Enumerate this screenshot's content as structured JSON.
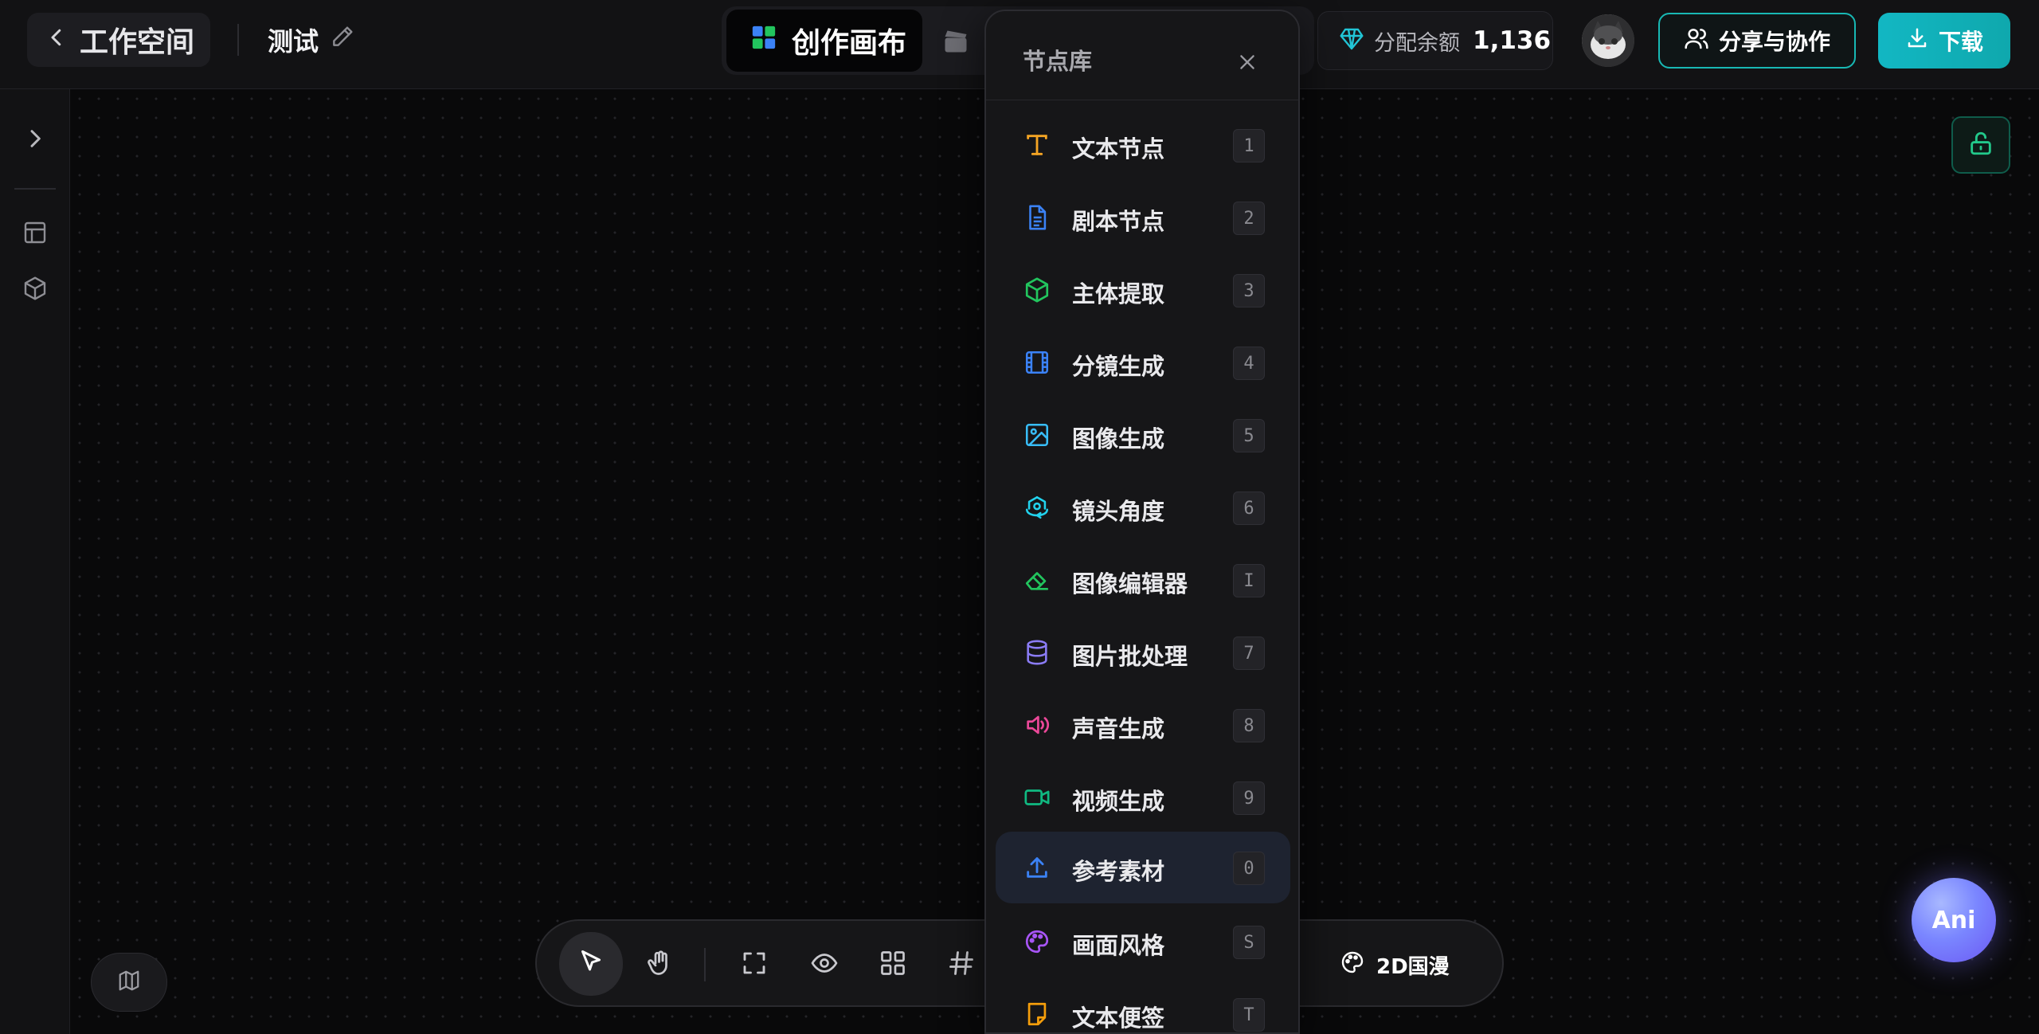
{
  "header": {
    "back_label": "工作空间",
    "project_name": "测试",
    "mode_active_label": "创作画布",
    "balance_label": "分配余额",
    "balance_value": "1,136",
    "share_label": "分享与协作",
    "download_label": "下载"
  },
  "node_library": {
    "title": "节点库",
    "items": [
      {
        "label": "文本节点",
        "key": "1",
        "icon": "text-type-icon",
        "color": "#f5a524"
      },
      {
        "label": "剧本节点",
        "key": "2",
        "icon": "document-icon",
        "color": "#3b82f6"
      },
      {
        "label": "主体提取",
        "key": "3",
        "icon": "cube-icon",
        "color": "#22c55e"
      },
      {
        "label": "分镜生成",
        "key": "4",
        "icon": "film-icon",
        "color": "#3b82f6"
      },
      {
        "label": "图像生成",
        "key": "5",
        "icon": "image-icon",
        "color": "#38bdf8"
      },
      {
        "label": "镜头角度",
        "key": "6",
        "icon": "orbit-camera-icon",
        "color": "#22d3ee"
      },
      {
        "label": "图像编辑器",
        "key": "I",
        "icon": "eraser-icon",
        "color": "#22c55e"
      },
      {
        "label": "图片批处理",
        "key": "7",
        "icon": "database-icon",
        "color": "#8b7cf6"
      },
      {
        "label": "声音生成",
        "key": "8",
        "icon": "speaker-icon",
        "color": "#ec4899"
      },
      {
        "label": "视频生成",
        "key": "9",
        "icon": "video-camera-icon",
        "color": "#10b981"
      },
      {
        "label": "参考素材",
        "key": "0",
        "icon": "upload-icon",
        "color": "#3b82f6",
        "highlighted": true
      },
      {
        "label": "画面风格",
        "key": "S",
        "icon": "palette-icon",
        "color": "#a855f7"
      },
      {
        "label": "文本便签",
        "key": "T",
        "icon": "sticky-note-icon",
        "color": "#f59e0b"
      }
    ]
  },
  "toolbar": {
    "partial_label": "ƒ",
    "style_label": "2D国漫"
  },
  "assistant": {
    "label": "Ani"
  },
  "colors": {
    "accent_teal": "#18b8b4",
    "lock_green": "#22c98b",
    "assistant_purple": "#7a86ff"
  }
}
